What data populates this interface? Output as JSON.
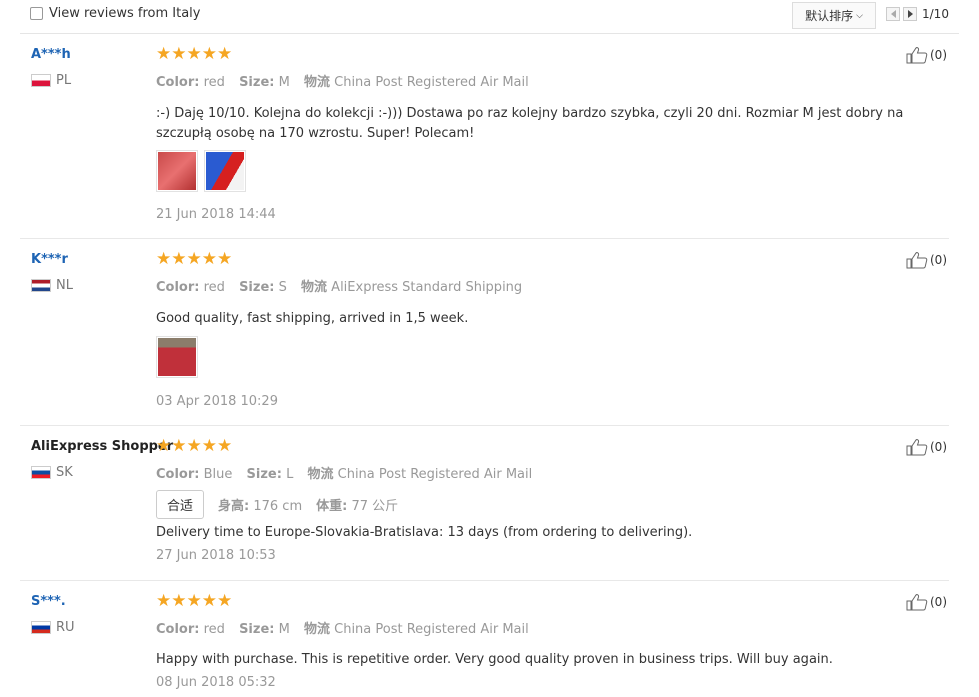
{
  "topbar": {
    "filter_label": "View reviews from Italy",
    "sort_label": "默认排序",
    "page": "1/10"
  },
  "colors": {
    "link": "#1e64b4",
    "star": "#f5a623",
    "muted": "#999999"
  },
  "reviews": [
    {
      "name": "A***h",
      "country": "PL",
      "meta": {
        "color_label": "Color:",
        "color": "red",
        "size_label": "Size:",
        "size": "M",
        "shipping_label": "物流",
        "shipping": "China Post Registered Air Mail"
      },
      "text": ":-) Daję 10/10. Kolejna do kolekcji :-))) Dostawa po raz kolejny bardzo szybka, czyli 20 dni. Rozmiar M jest dobry na szczupłą osobę na 170 wzrostu. Super! Polecam!",
      "date": "21 Jun 2018 14:44",
      "likes": "(0)",
      "rating": 5
    },
    {
      "name": "K***r",
      "country": "NL",
      "meta": {
        "color_label": "Color:",
        "color": "red",
        "size_label": "Size:",
        "size": "S",
        "shipping_label": "物流",
        "shipping": "AliExpress Standard Shipping"
      },
      "text": "Good quality, fast shipping, arrived in 1,5 week.",
      "date": "03 Apr 2018 10:29",
      "likes": "(0)",
      "rating": 5
    },
    {
      "name": "AliExpress Shopper",
      "country": "SK",
      "meta": {
        "color_label": "Color:",
        "color": "Blue",
        "size_label": "Size:",
        "size": "L",
        "shipping_label": "物流",
        "shipping": "China Post Registered Air Mail"
      },
      "fit": {
        "tag": "合适",
        "height_label": "身高:",
        "height": "176 cm",
        "weight_label": "体重:",
        "weight": "77 公斤"
      },
      "text": "Delivery time to Europe-Slovakia-Bratislava: 13 days (from ordering to delivering).",
      "date": "27 Jun 2018 10:53",
      "likes": "(0)",
      "rating": 5
    },
    {
      "name": "S***.",
      "country": "RU",
      "meta": {
        "color_label": "Color:",
        "color": "red",
        "size_label": "Size:",
        "size": "M",
        "shipping_label": "物流",
        "shipping": "China Post Registered Air Mail"
      },
      "text": "Happy with purchase. This is repetitive order. Very good quality proven in business trips. Will buy again.",
      "date": "08 Jun 2018 05:32",
      "likes": "(0)",
      "rating": 5
    }
  ]
}
